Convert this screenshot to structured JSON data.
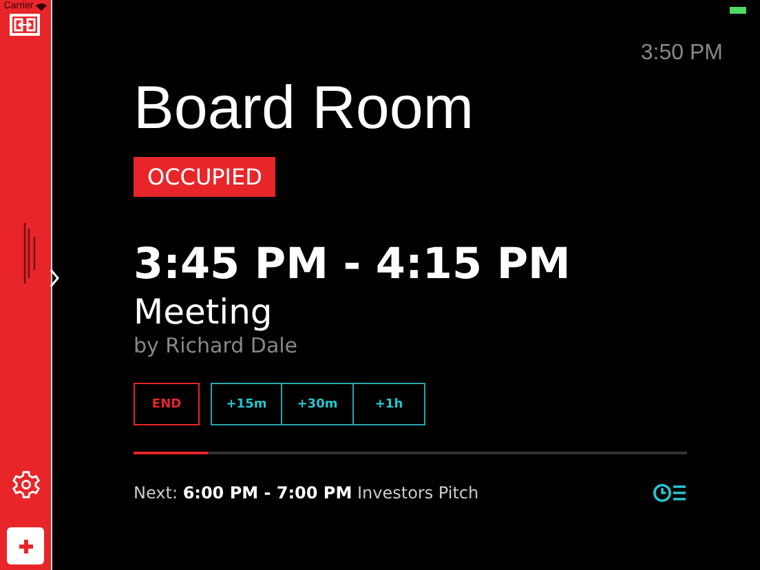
{
  "status_bar": {
    "carrier": "Carrier"
  },
  "clock": "3:50 PM",
  "room": {
    "name": "Board Room",
    "status": "OCCUPIED",
    "occupied": true
  },
  "meeting": {
    "time": "3:45 PM - 4:15 PM",
    "title": "Meeting",
    "organizer": "by Richard Dale"
  },
  "actions": [
    {
      "label": "END",
      "kind": "end"
    },
    {
      "label": "+15m",
      "kind": "extend"
    },
    {
      "label": "+30m",
      "kind": "extend"
    },
    {
      "label": "+1h",
      "kind": "extend"
    }
  ],
  "progress": {
    "level": 0.135
  },
  "next": {
    "text": "Next: **6:00 PM - 7:00 PM** Investors Pitch"
  }
}
